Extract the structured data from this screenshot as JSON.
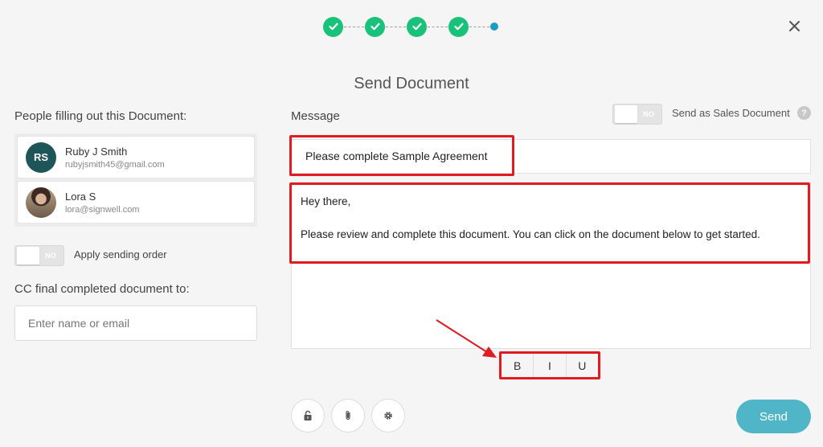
{
  "title": "Send Document",
  "progress": {
    "completed_steps": 4,
    "total_steps": 5
  },
  "left": {
    "signers_heading": "People filling out this Document:",
    "signers": [
      {
        "initials": "RS",
        "name": "Ruby J Smith",
        "email": "rubyjsmith45@gmail.com"
      },
      {
        "initials": "",
        "name": "Lora S",
        "email": "lora@signwell.com"
      }
    ],
    "sending_order_toggle": "NO",
    "sending_order_label": "Apply sending order",
    "cc_heading": "CC final completed document to:",
    "cc_placeholder": "Enter name or email"
  },
  "right": {
    "message_label": "Message",
    "sales_toggle": "NO",
    "sales_label": "Send as Sales Document",
    "help": "?",
    "subject": "Please complete Sample Agreement",
    "body_line1": "Hey there,",
    "body_line2": "Please review and complete this document. You can click on the document below to get started."
  },
  "format": {
    "bold": "B",
    "italic": "I",
    "underline": "U"
  },
  "send_label": "Send",
  "colors": {
    "accent": "#4fb5c7",
    "step_done": "#19c27a",
    "step_current": "#1a9ec0",
    "highlight": "#e01b22"
  }
}
